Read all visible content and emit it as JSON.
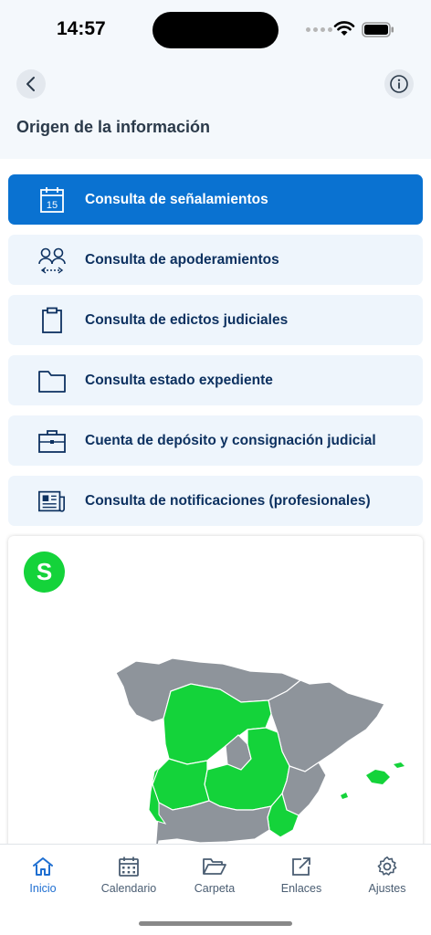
{
  "status": {
    "time": "14:57"
  },
  "header": {
    "title": "Origen de la información"
  },
  "menu": {
    "items": [
      {
        "label": "Consulta de señalamientos",
        "icon": "calendar-15-icon",
        "calendar_day": "15"
      },
      {
        "label": "Consulta de apoderamientos",
        "icon": "people-exchange-icon"
      },
      {
        "label": "Consulta de edictos judiciales",
        "icon": "clipboard-icon"
      },
      {
        "label": "Consulta estado expediente",
        "icon": "folder-icon"
      },
      {
        "label": "Cuenta de depósito y consignación judicial",
        "icon": "briefcase-icon"
      },
      {
        "label": "Consulta de notificaciones (profesionales)",
        "icon": "newspaper-icon"
      }
    ]
  },
  "map": {
    "badge": "S",
    "highlight_color": "#14d33a",
    "region_color": "#8e949b"
  },
  "tabs": [
    {
      "label": "Inicio",
      "icon": "home-icon"
    },
    {
      "label": "Calendario",
      "icon": "calendar-icon"
    },
    {
      "label": "Carpeta",
      "icon": "folder-open-icon"
    },
    {
      "label": "Enlaces",
      "icon": "external-link-icon"
    },
    {
      "label": "Ajustes",
      "icon": "gear-icon"
    }
  ],
  "colors": {
    "accent": "#0a72d1",
    "item_bg": "#eef5fc",
    "text_dark": "#0d3160"
  }
}
